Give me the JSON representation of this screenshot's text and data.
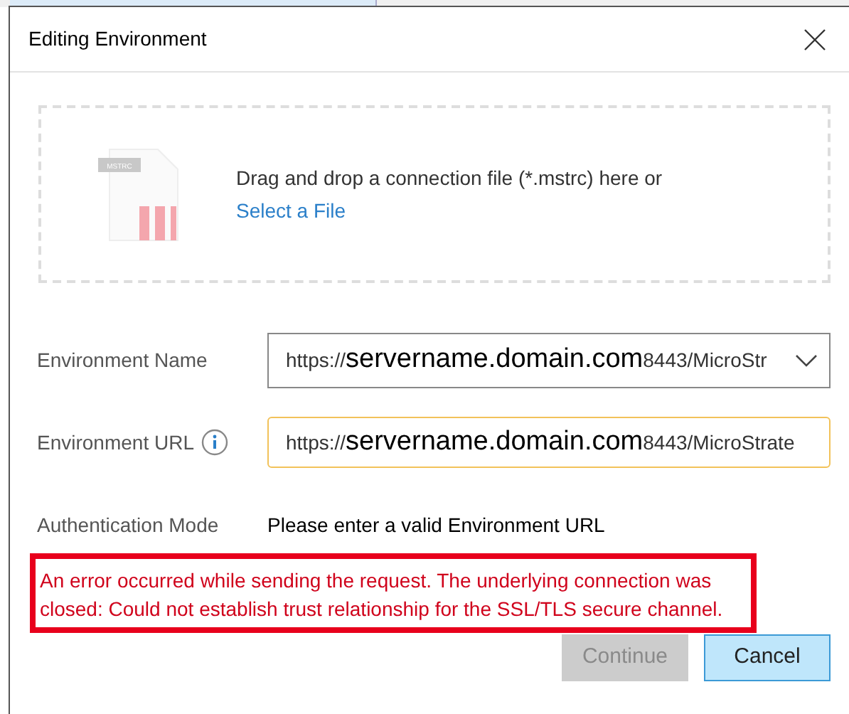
{
  "dialog": {
    "title": "Editing Environment"
  },
  "drop_zone": {
    "file_badge": "MSTRC",
    "text": "Drag and drop a connection file (*.mstrc) here or",
    "link": "Select a File"
  },
  "fields": [
    {
      "kind": "select",
      "label": "Environment Name",
      "value_parts": [
        "https://",
        "servername.domain.com",
        "8443/MicroStr"
      ],
      "info": false
    },
    {
      "kind": "input",
      "label": "Environment URL",
      "value_parts": [
        "https://",
        "servername.domain.com",
        "8443/MicroStrate"
      ],
      "info": true
    },
    {
      "kind": "text",
      "label": "Authentication Mode",
      "value_parts": [
        "Please enter a valid Environment URL"
      ],
      "info": false
    }
  ],
  "error": {
    "message": "An error occurred while sending the request. The underlying connection was closed: Could not establish trust relationship for the SSL/TLS secure channel."
  },
  "buttons": [
    {
      "label": "Continue",
      "disabled": true,
      "kind": "primary"
    },
    {
      "label": "Cancel",
      "disabled": false,
      "kind": "secondary"
    }
  ]
}
